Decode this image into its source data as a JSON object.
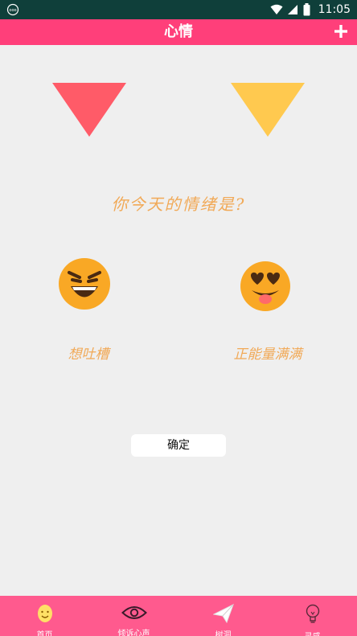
{
  "status_bar": {
    "time": "11:05",
    "icons": [
      "app-notification-icon",
      "wifi-icon",
      "signal-icon",
      "battery-icon"
    ]
  },
  "app_bar": {
    "title": "心情",
    "add_icon": "plus-icon"
  },
  "colors": {
    "app_bar": "#ff3f7a",
    "status_bar": "#0f3f3a",
    "triangle_left": "#ff5b68",
    "triangle_right": "#ffc94f",
    "accent_text": "#f1a957",
    "bottom_nav": "#ff5a8e"
  },
  "main": {
    "question": "你今天的情绪是?",
    "moods": [
      {
        "label": "想吐槽",
        "icon": "angry-face-icon"
      },
      {
        "label": "正能量满满",
        "icon": "heart-eyes-face-icon"
      }
    ],
    "confirm_label": "确定"
  },
  "bottom_nav": {
    "items": [
      {
        "label": "首页",
        "icon": "smiley-icon"
      },
      {
        "label": "倾诉心声",
        "icon": "eye-icon"
      },
      {
        "label": "树洞",
        "icon": "paper-plane-icon"
      },
      {
        "label": "灵感",
        "icon": "lightbulb-icon"
      }
    ]
  }
}
